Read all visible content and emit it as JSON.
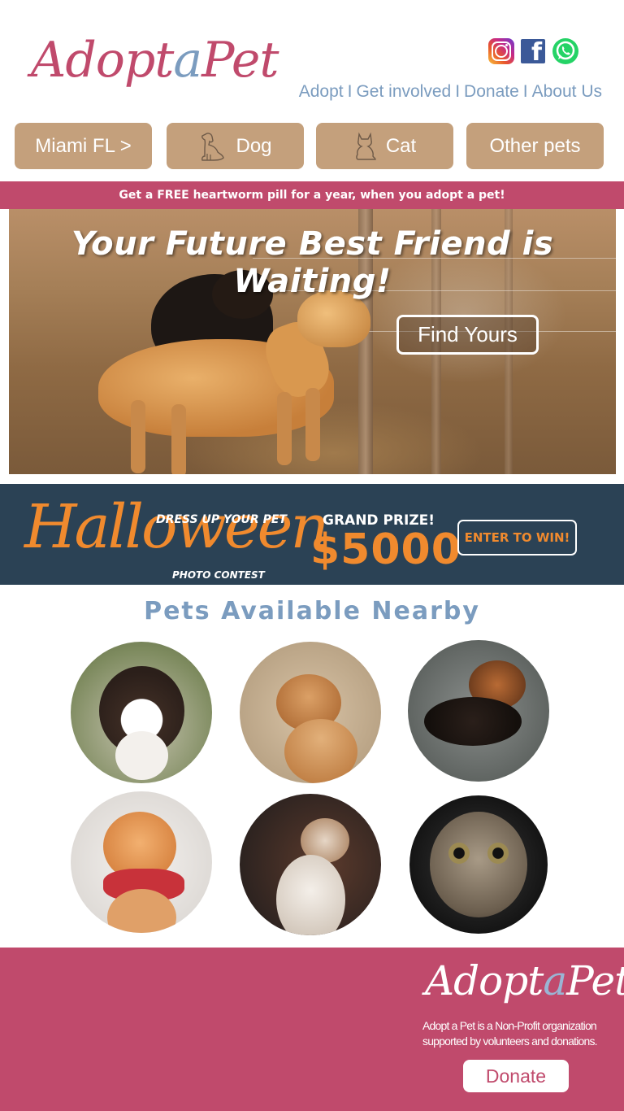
{
  "header": {
    "logo_part1": "Adopt",
    "logo_accent": "a",
    "logo_part2": "Pet",
    "social": [
      "instagram-icon",
      "facebook-icon",
      "whatsapp-icon"
    ],
    "nav": [
      "Adopt",
      "Get involved",
      "Donate",
      "About Us"
    ],
    "nav_separator": "I"
  },
  "categories": {
    "location": "Miami FL >",
    "dog": "Dog",
    "cat": "Cat",
    "other": "Other pets"
  },
  "promo": "Get a FREE heartworm pill for a year, when you adopt a pet!",
  "hero": {
    "title": "Your Future Best Friend is Waiting!",
    "cta": "Find Yours"
  },
  "halloween": {
    "title": "Halloween",
    "dress_up": "DRESS UP YOUR PET",
    "photo_contest": "PHOTO CONTEST",
    "grand_prize": "GRAND PRIZE!",
    "prize_amount": "$5000",
    "enter": "ENTER TO WIN!"
  },
  "pets": {
    "heading": "Pets Available Nearby"
  },
  "footer": {
    "logo_part1": "Adopt",
    "logo_accent": "a",
    "logo_part2": "Pet",
    "text": "Adopt a Pet is a Non-Profit organization supported  by volunteers and donations.",
    "donate": "Donate"
  },
  "colors": {
    "brand_pink": "#c04a6c",
    "brand_blue": "#7b9cbf",
    "button_tan": "#c4a07c",
    "banner_navy": "#2b4255",
    "halloween_orange": "#f08a2e"
  }
}
